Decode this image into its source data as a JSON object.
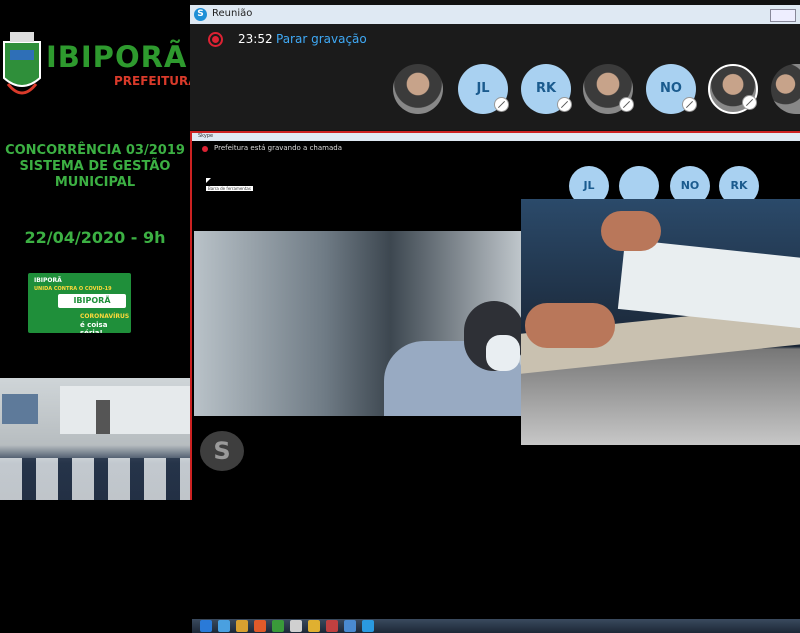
{
  "left_panel": {
    "city": "IBIPORÃ",
    "subtitle": "PREFEITURA",
    "tender_line1": "CONCORRÊNCIA 03/2019",
    "tender_line2": "SISTEMA DE GESTÃO",
    "tender_line3": "MUNICIPAL",
    "date": "22/04/2020 - 9h",
    "banner": {
      "line1": "IBIPORÃ",
      "line2": "UNIDA CONTRA O COVID-19",
      "brand": "IBIPORÃ",
      "line3": "CORONAVÍRUS",
      "line4": "é coisa séria!"
    }
  },
  "window": {
    "title": "Reunião",
    "timer": "23:52",
    "stop_recording": "Parar gravação",
    "participants": [
      {
        "initials": ""
      },
      {
        "initials": "JL"
      },
      {
        "initials": "RK"
      },
      {
        "initials": ""
      },
      {
        "initials": "NO"
      },
      {
        "initials": ""
      },
      {
        "initials": ""
      }
    ]
  },
  "inner_call": {
    "title": "Skype",
    "recording_notice": "Prefeitura está gravando a chamada",
    "tooltip": "Barra de ferramentas",
    "participants": [
      "JL",
      "",
      "NO",
      "RK"
    ],
    "logo": "S"
  },
  "colors": {
    "brand_green": "#2e9a2e",
    "record_red": "#dd2233",
    "skype_blue": "#1e8fd6",
    "link_blue": "#3fa9f5"
  }
}
